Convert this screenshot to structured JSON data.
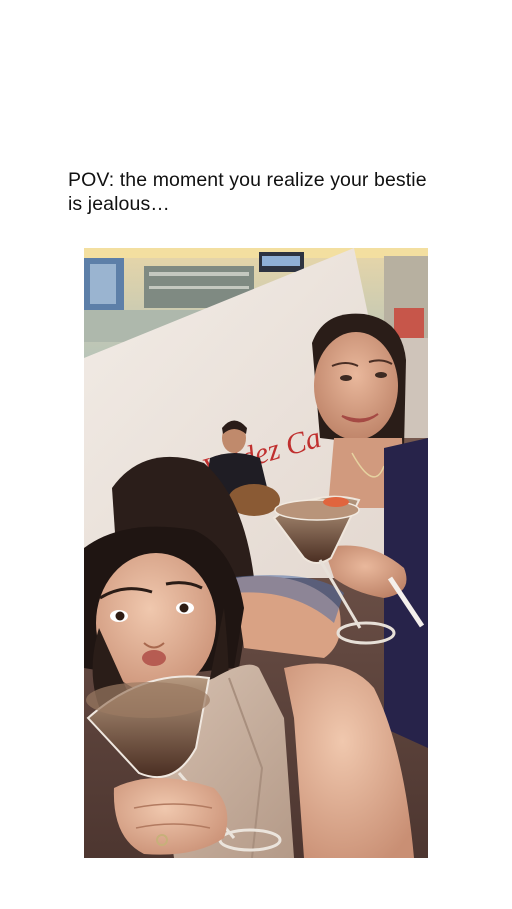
{
  "caption": {
    "line1": "POV: the moment you realize your bestie",
    "line2": "is jealous…"
  },
  "photo": {
    "sign_text": "Valdez Ca"
  },
  "colors": {
    "background": "#ffffff",
    "caption_text": "#111111",
    "sign_red": "#c0302f"
  }
}
